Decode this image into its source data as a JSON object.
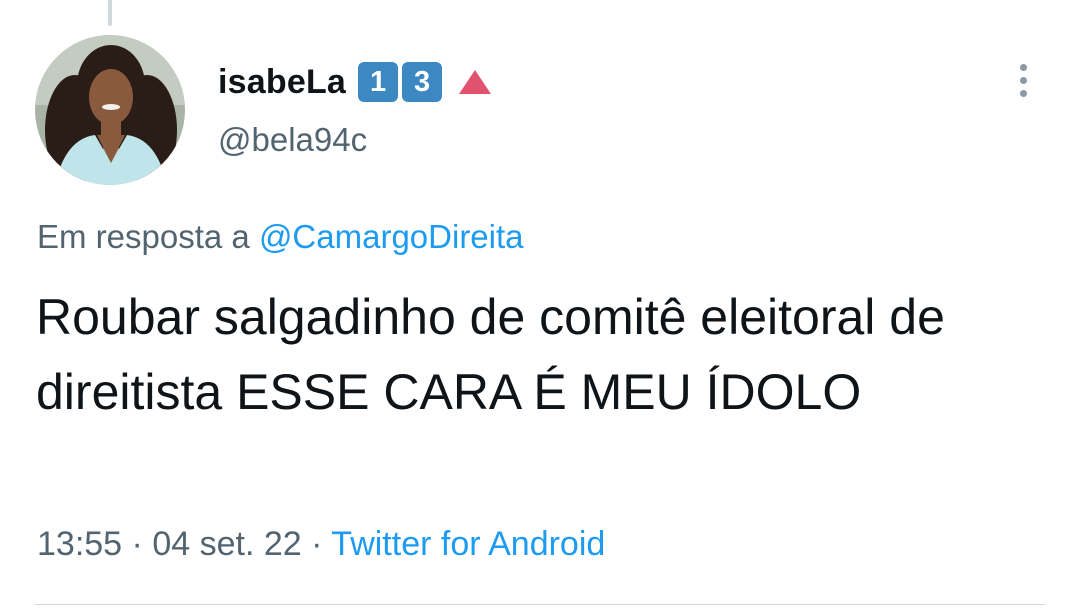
{
  "tweet": {
    "author": {
      "display_name": "isabeLa",
      "badges": [
        "1",
        "3"
      ],
      "handle": "@bela94c"
    },
    "reply": {
      "prefix": "Em resposta a",
      "mention": "@CamargoDireita"
    },
    "text": "Roubar salgadinho de comitê eleitoral de direitista ESSE CARA É MEU ÍDOLO",
    "meta": {
      "time": "13:55",
      "separator": "·",
      "date": "04 set. 22",
      "source": "Twitter for Android"
    }
  },
  "icons": {
    "badge_color": "#3b88c3",
    "triangle": "red-up-triangle-icon",
    "more": "more-options-icon"
  },
  "colors": {
    "link": "#1d9bf0",
    "secondary_text": "#536471",
    "primary_text": "#0f1419"
  }
}
